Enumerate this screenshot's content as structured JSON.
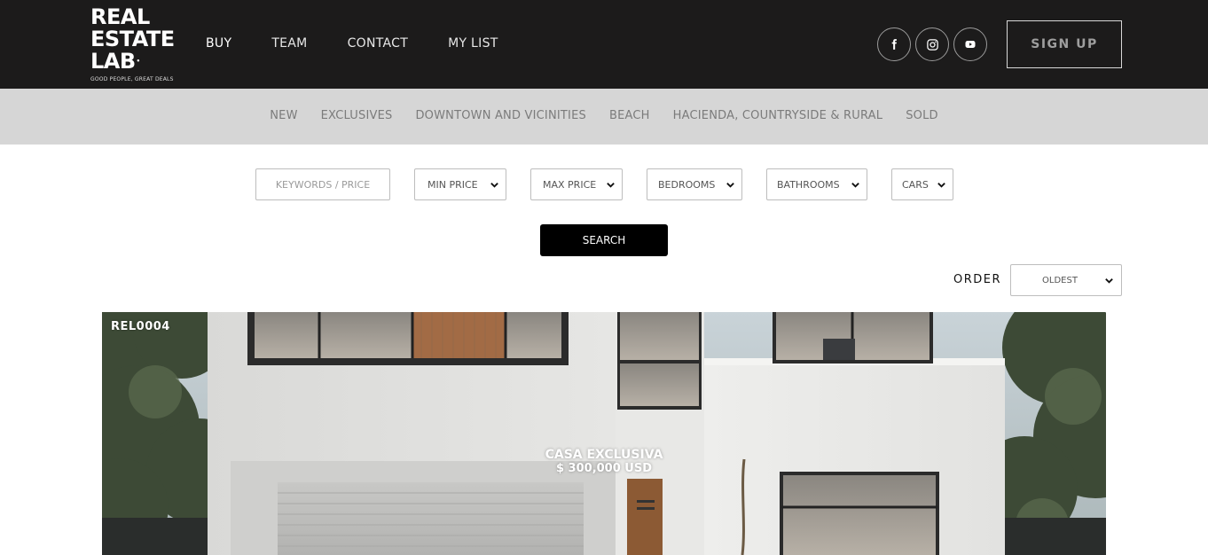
{
  "brand": {
    "logo_lines": [
      "REAL",
      "ESTATE",
      "LAB"
    ],
    "tagline": "GOOD PEOPLE, GREAT DEALS"
  },
  "nav": {
    "items": [
      {
        "label": "BUY"
      },
      {
        "label": "TEAM"
      },
      {
        "label": "CONTACT"
      },
      {
        "label": "MY LIST"
      }
    ]
  },
  "social": [
    "facebook-icon",
    "instagram-icon",
    "youtube-icon"
  ],
  "signup": {
    "label": "SIGN UP"
  },
  "categories": [
    {
      "label": "NEW"
    },
    {
      "label": "EXCLUSIVES"
    },
    {
      "label": "DOWNTOWN AND VICINITIES"
    },
    {
      "label": "BEACH"
    },
    {
      "label": "HACIENDA, COUNTRYSIDE & RURAL"
    },
    {
      "label": "SOLD"
    }
  ],
  "filters": {
    "keywords_placeholder": "KEYWORDS / PRICE",
    "min_price": "MIN PRICE",
    "max_price": "MAX PRICE",
    "bedrooms": "BEDROOMS",
    "bathrooms": "BATHROOMS",
    "cars": "CARS",
    "search_label": "SEARCH"
  },
  "order": {
    "label": "ORDER",
    "selected": "OLDEST"
  },
  "listing": {
    "ref": "REL0004",
    "title": "CASA EXCLUSIVA",
    "price": "$ 300,000 USD"
  },
  "colors": {
    "header_bg": "#1c1b1b",
    "category_bg": "#d6d6d6",
    "search_button": "#000000"
  }
}
